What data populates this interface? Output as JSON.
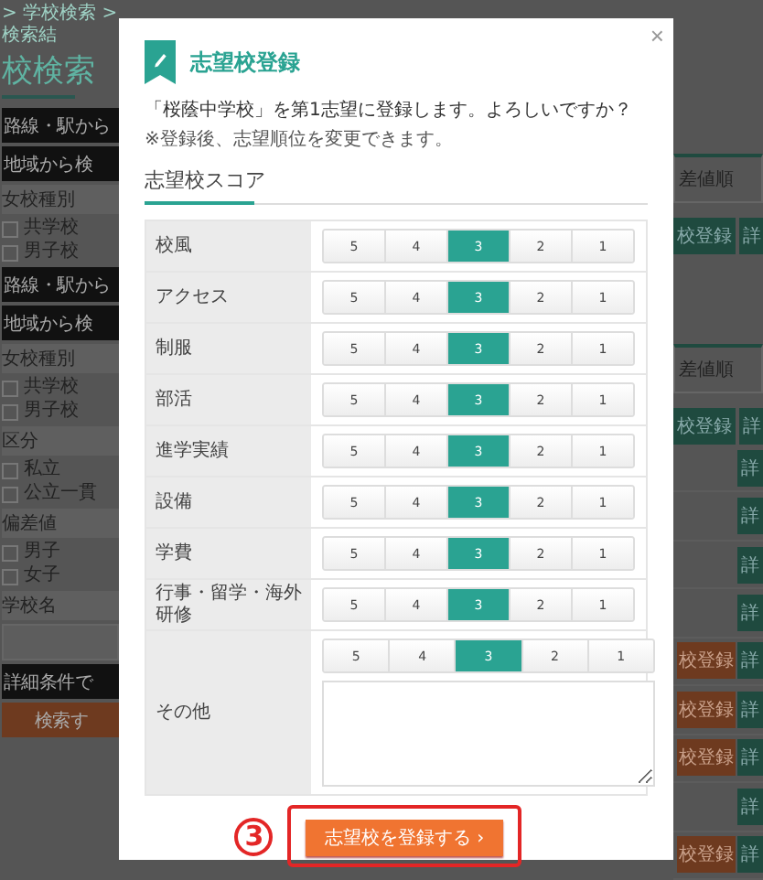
{
  "background": {
    "breadcrumb": "> 学校検索 > 検索結",
    "heading": "校検索",
    "left_items": [
      {
        "kind": "dark-button",
        "label": "路線・駅から"
      },
      {
        "kind": "dark-button",
        "label": "地域から検"
      },
      {
        "kind": "label",
        "label": "女校種別"
      },
      {
        "kind": "checks",
        "items": [
          {
            "label": "共学校",
            "checked": false
          },
          {
            "label": "男子校",
            "checked": false
          }
        ]
      },
      {
        "kind": "dark-button",
        "label": "路線・駅から"
      },
      {
        "kind": "dark-button",
        "label": "地域から検"
      },
      {
        "kind": "label",
        "label": "女校種別"
      },
      {
        "kind": "checks",
        "items": [
          {
            "label": "共学校",
            "checked": false
          },
          {
            "label": "男子校",
            "checked": false
          }
        ]
      },
      {
        "kind": "label",
        "label": "区分"
      },
      {
        "kind": "checks",
        "items": [
          {
            "label": "私立",
            "checked": false
          },
          {
            "label": "公立一貫",
            "checked": false
          }
        ]
      },
      {
        "kind": "label",
        "label": "偏差値"
      },
      {
        "kind": "checks",
        "items": [
          {
            "label": "男子",
            "checked": false
          },
          {
            "label": "女子",
            "checked": false
          }
        ]
      },
      {
        "kind": "label",
        "label": "学校名"
      },
      {
        "kind": "input"
      },
      {
        "kind": "dark-button",
        "label": "詳細条件で"
      },
      {
        "kind": "orange-button",
        "label": "検索す"
      }
    ],
    "right_rows": [
      {
        "kind": "sort",
        "label": "差値順"
      },
      {
        "kind": "header",
        "cells": [
          "校登録",
          "詳"
        ]
      },
      {
        "kind": "gap"
      },
      {
        "kind": "sort",
        "label": "差値順"
      },
      {
        "kind": "header",
        "cells": [
          "校登録",
          "詳"
        ]
      },
      {
        "kind": "row",
        "detail": "詳"
      },
      {
        "kind": "row",
        "detail": "詳"
      },
      {
        "kind": "row",
        "detail": "詳"
      },
      {
        "kind": "row",
        "detail": "詳"
      },
      {
        "kind": "row",
        "register": "校登録",
        "detail": "詳"
      },
      {
        "kind": "row",
        "register": "校登録",
        "detail": "詳"
      },
      {
        "kind": "row",
        "register": "校登録",
        "detail": "詳"
      },
      {
        "kind": "row",
        "detail": "詳"
      },
      {
        "kind": "row",
        "register": "校登録",
        "detail": "詳"
      }
    ]
  },
  "modal": {
    "close": "×",
    "title": "志望校登録",
    "message": "「桜蔭中学校」を第1志望に登録します。よろしいですか？",
    "note": "※登録後、志望順位を変更できます。",
    "section_title": "志望校スコア",
    "score_rows": [
      {
        "label": "校風",
        "options": [
          {
            "label": "5",
            "selected": false
          },
          {
            "label": "4",
            "selected": false
          },
          {
            "label": "3",
            "selected": true
          },
          {
            "label": "2",
            "selected": false
          },
          {
            "label": "1",
            "selected": false
          }
        ]
      },
      {
        "label": "アクセス",
        "options": [
          {
            "label": "5",
            "selected": false
          },
          {
            "label": "4",
            "selected": false
          },
          {
            "label": "3",
            "selected": true
          },
          {
            "label": "2",
            "selected": false
          },
          {
            "label": "1",
            "selected": false
          }
        ]
      },
      {
        "label": "制服",
        "options": [
          {
            "label": "5",
            "selected": false
          },
          {
            "label": "4",
            "selected": false
          },
          {
            "label": "3",
            "selected": true
          },
          {
            "label": "2",
            "selected": false
          },
          {
            "label": "1",
            "selected": false
          }
        ]
      },
      {
        "label": "部活",
        "options": [
          {
            "label": "5",
            "selected": false
          },
          {
            "label": "4",
            "selected": false
          },
          {
            "label": "3",
            "selected": true
          },
          {
            "label": "2",
            "selected": false
          },
          {
            "label": "1",
            "selected": false
          }
        ]
      },
      {
        "label": "進学実績",
        "options": [
          {
            "label": "5",
            "selected": false
          },
          {
            "label": "4",
            "selected": false
          },
          {
            "label": "3",
            "selected": true
          },
          {
            "label": "2",
            "selected": false
          },
          {
            "label": "1",
            "selected": false
          }
        ]
      },
      {
        "label": "設備",
        "options": [
          {
            "label": "5",
            "selected": false
          },
          {
            "label": "4",
            "selected": false
          },
          {
            "label": "3",
            "selected": true
          },
          {
            "label": "2",
            "selected": false
          },
          {
            "label": "1",
            "selected": false
          }
        ]
      },
      {
        "label": "学費",
        "options": [
          {
            "label": "5",
            "selected": false
          },
          {
            "label": "4",
            "selected": false
          },
          {
            "label": "3",
            "selected": true
          },
          {
            "label": "2",
            "selected": false
          },
          {
            "label": "1",
            "selected": false
          }
        ]
      },
      {
        "label": "行事・留学・海外研修",
        "options": [
          {
            "label": "5",
            "selected": false
          },
          {
            "label": "4",
            "selected": false
          },
          {
            "label": "3",
            "selected": true
          },
          {
            "label": "2",
            "selected": false
          },
          {
            "label": "1",
            "selected": false
          }
        ]
      }
    ],
    "other": {
      "label": "その他",
      "options": [
        {
          "label": "5",
          "selected": false
        },
        {
          "label": "4",
          "selected": false
        },
        {
          "label": "3",
          "selected": true
        },
        {
          "label": "2",
          "selected": false
        },
        {
          "label": "1",
          "selected": false
        }
      ]
    },
    "submit": "志望校を登録する ›"
  },
  "annotation": {
    "step": "3"
  }
}
